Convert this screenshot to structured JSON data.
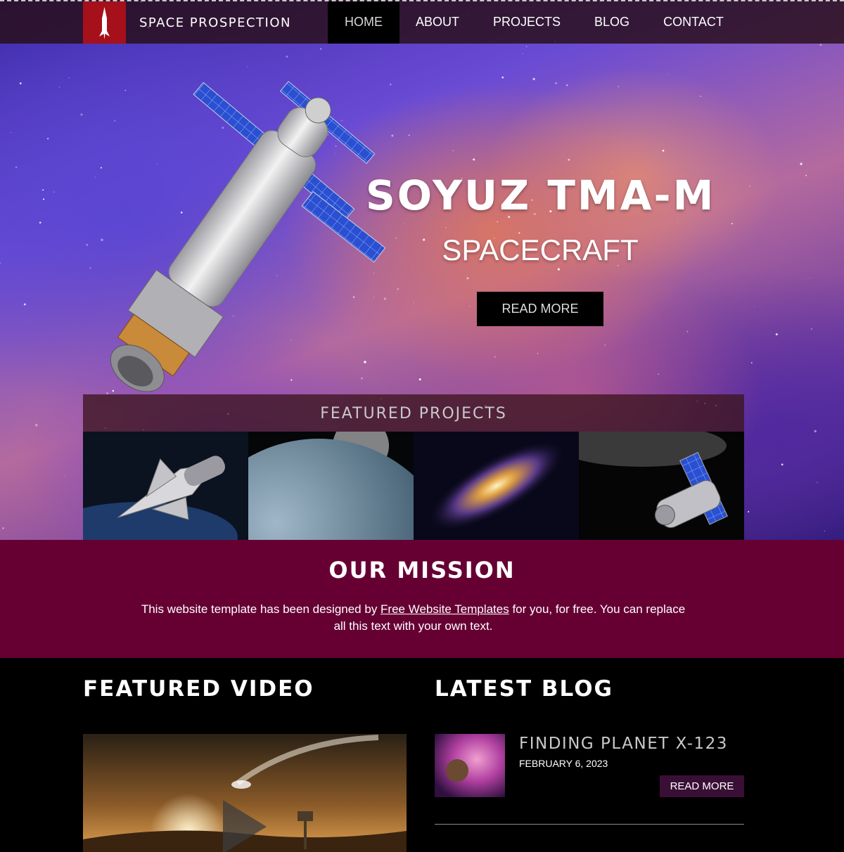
{
  "nav": {
    "brand": "SPACE PROSPECTION",
    "items": [
      {
        "label": "HOME",
        "active": true
      },
      {
        "label": "ABOUT",
        "active": false
      },
      {
        "label": "PROJECTS",
        "active": false
      },
      {
        "label": "BLOG",
        "active": false
      },
      {
        "label": "CONTACT",
        "active": false
      }
    ]
  },
  "hero": {
    "title": "SOYUZ TMA-M",
    "subtitle": "SPACECRAFT",
    "button_label": "READ MORE"
  },
  "featured_projects": {
    "title": "FEATURED PROJECTS",
    "thumbnails": [
      "space-shuttle",
      "planet-earth",
      "spiral-galaxy",
      "space-station"
    ]
  },
  "mission": {
    "title": "OUR MISSION",
    "text_before_link": "This website template has been designed by ",
    "link_text": "Free Website Templates",
    "text_after_link": " for you, for free. You can replace all this text with your own text."
  },
  "featured_video": {
    "title": "FEATURED VIDEO"
  },
  "latest_blog": {
    "title": "LATEST BLOG",
    "post": {
      "title": "FINDING PLANET X-123",
      "date": "FEBRUARY 6, 2023",
      "button_label": "READ MORE"
    }
  },
  "colors": {
    "nav_background": "#280e16",
    "logo_red": "#a5101b",
    "mission_background": "#660033",
    "blog_button": "#3a0f35"
  }
}
